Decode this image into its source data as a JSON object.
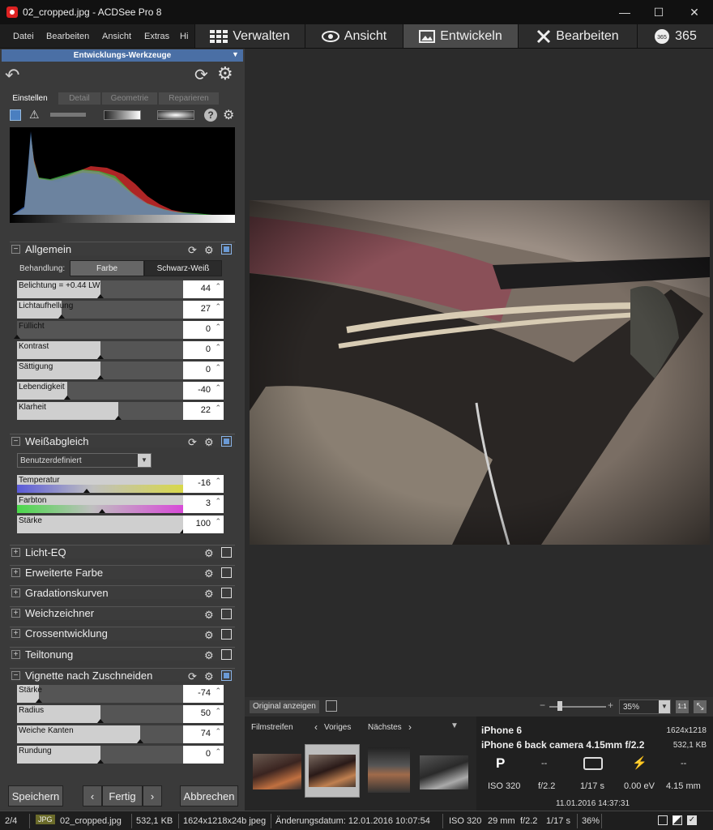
{
  "window": {
    "title": "02_cropped.jpg - ACDSee Pro 8",
    "minimize": "—",
    "maximize": "☐",
    "close": "✕"
  },
  "menu": [
    "Datei",
    "Bearbeiten",
    "Ansicht",
    "Extras",
    "Hi"
  ],
  "modes": [
    "Verwalten",
    "Ansicht",
    "Entwickeln",
    "Bearbeiten",
    "365"
  ],
  "panel": {
    "title": "Entwicklungs-Werkzeuge",
    "tabs": [
      "Einstellen",
      "Detail",
      "Geometrie",
      "Reparieren"
    ],
    "general": {
      "title": "Allgemein",
      "treatment_label": "Behandlung:",
      "treatment_options": [
        "Farbe",
        "Schwarz-Weiß"
      ],
      "sliders": [
        {
          "label": "Belichtung = +0.44 LW",
          "value": "44",
          "level": 0.5
        },
        {
          "label": "Lichtaufhellung",
          "value": "27",
          "level": 0.27
        },
        {
          "label": "Füllicht",
          "value": "0",
          "level": 0.0
        },
        {
          "label": "Kontrast",
          "value": "0",
          "level": 0.5
        },
        {
          "label": "Sättigung",
          "value": "0",
          "level": 0.5
        },
        {
          "label": "Lebendigkeit",
          "value": "-40",
          "level": 0.3
        },
        {
          "label": "Klarheit",
          "value": "22",
          "level": 0.61
        }
      ]
    },
    "wb": {
      "title": "Weißabgleich",
      "preset": "Benutzerdefiniert",
      "sliders": [
        {
          "label": "Temperatur",
          "value": "-16",
          "level": 0.42
        },
        {
          "label": "Farbton",
          "value": "3",
          "level": 0.51
        },
        {
          "label": "Stärke",
          "value": "100",
          "level": 1.0
        }
      ]
    },
    "collapsed": [
      "Licht-EQ",
      "Erweiterte Farbe",
      "Gradationskurven",
      "Weichzeichner",
      "Crossentwicklung",
      "Teiltonung"
    ],
    "vignette": {
      "title": "Vignette nach Zuschneiden",
      "sliders": [
        {
          "label": "Stärke",
          "value": "-74",
          "level": 0.13
        },
        {
          "label": "Radius",
          "value": "50",
          "level": 0.5
        },
        {
          "label": "Weiche Kanten",
          "value": "74",
          "level": 0.74
        },
        {
          "label": "Rundung",
          "value": "0",
          "level": 0.5
        }
      ]
    },
    "buttons": {
      "save": "Speichern",
      "prev": "‹",
      "done": "Fertig",
      "next": "›",
      "cancel": "Abbrechen"
    }
  },
  "viewer": {
    "show_original": "Original anzeigen",
    "zoom": "35%",
    "zoom_11": "1:1"
  },
  "filmstrip": {
    "label": "Filmstreifen",
    "prev": "Voriges",
    "next": "Nächstes"
  },
  "info": {
    "camera": "iPhone 6",
    "dims": "1624x1218",
    "lens": "iPhone 6 back camera 4.15mm f/2.2",
    "size": "532,1 KB",
    "mode": "P",
    "metering": "--",
    "flash": "--",
    "iso": "ISO 320",
    "aperture": "f/2.2",
    "shutter": "1/17 s",
    "ev": "0.00 eV",
    "focal": "4.15 mm",
    "date": "11.01.2016 14:37:31"
  },
  "status": {
    "index": "2/4",
    "type": "JPG",
    "file": "02_cropped.jpg",
    "size": "532,1 KB",
    "dims": "1624x1218x24b jpeg",
    "modified": "Änderungsdatum: 12.01.2016 10:07:54",
    "iso": "ISO 320",
    "focal": "29 mm",
    "aperture": "f/2.2",
    "shutter": "1/17 s",
    "zoom": "36%"
  },
  "colors": {
    "accent": "#4a6fa5",
    "panel": "#3a3a3a",
    "titlebar": "#111111"
  }
}
